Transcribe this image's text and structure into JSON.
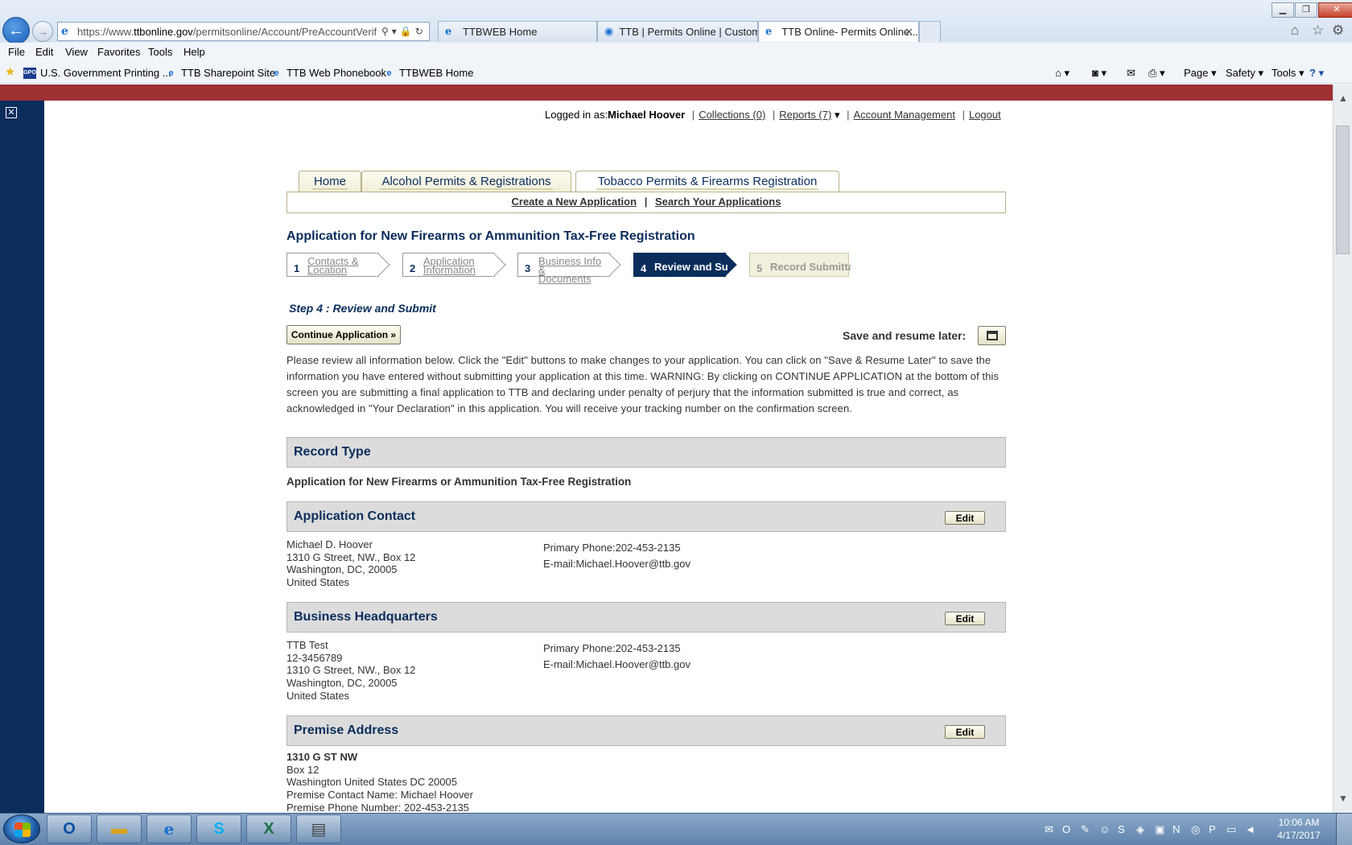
{
  "browser": {
    "url_prefix": "https://www.",
    "url_domain": "ttbonline.gov",
    "url_path": "/permitsonline/Account/PreAccountVerific",
    "tabs": [
      {
        "label": "TTBWEB Home"
      },
      {
        "label": "TTB | Permits Online | Custom..."
      },
      {
        "label": "TTB Online- Permits Online..."
      }
    ],
    "menu": [
      "File",
      "Edit",
      "View",
      "Favorites",
      "Tools",
      "Help"
    ],
    "favorites": [
      "U.S. Government Printing ...",
      "TTB Sharepoint Site",
      "TTB Web Phonebook",
      "TTBWEB Home"
    ],
    "commands": [
      "Page",
      "Safety",
      "Tools"
    ]
  },
  "header": {
    "logged_in_label": "Logged in as:",
    "user_name": "Michael Hoover",
    "collections": "Collections (0)",
    "reports": "Reports (7)",
    "account_management": "Account Management",
    "logout": "Logout"
  },
  "tabs": {
    "home": "Home",
    "alcohol": "Alcohol Permits & Registrations",
    "tobacco": "Tobacco Permits & Firearms Registration"
  },
  "subnav": {
    "create": "Create a New Application",
    "search": "Search Your Applications"
  },
  "page_title": "Application for New Firearms or Ammunition Tax-Free Registration",
  "steps": [
    {
      "num": "1",
      "line1": "Contacts &",
      "line2": "Location"
    },
    {
      "num": "2",
      "line1": "Application",
      "line2": "Information"
    },
    {
      "num": "3",
      "line1": "Business Info &",
      "line2": "Documents"
    },
    {
      "num": "4",
      "label": "Review and Submit"
    },
    {
      "num": "5",
      "label": "Record Submittal"
    }
  ],
  "step_heading": "Step 4 : Review and Submit",
  "continue_label": "Continue Application »",
  "save_label": "Save and resume later:",
  "instructions": "Please review all information below. Click the \"Edit\" buttons to make changes to your application. You can click on \"Save & Resume Later\" to save the information you have entered without submitting your application at this time. WARNING: By clicking on CONTINUE APPLICATION at the bottom of this screen you are submitting a final application to TTB and declaring under penalty of perjury that the information submitted is true and correct, as acknowledged in \"Your Declaration\" in this application. You will receive your tracking number on the confirmation screen.",
  "edit_label": "Edit",
  "record_type": {
    "title": "Record Type",
    "value": "Application for New Firearms or Ammunition Tax-Free Registration"
  },
  "application_contact": {
    "title": "Application Contact",
    "address": [
      "Michael D. Hoover",
      "1310 G Street, NW., Box 12",
      "Washington, DC, 20005",
      "United States"
    ],
    "phone": "Primary Phone:202-453-2135",
    "email": "E-mail:Michael.Hoover@ttb.gov"
  },
  "business_hq": {
    "title": "Business Headquarters",
    "address": [
      "TTB Test",
      "12-3456789",
      "1310 G Street, NW., Box 12",
      "Washington, DC, 20005",
      "United States"
    ],
    "phone": "Primary Phone:202-453-2135",
    "email": "E-mail:Michael.Hoover@ttb.gov"
  },
  "premise": {
    "title": "Premise Address",
    "street": "1310 G ST NW",
    "lines": [
      "Box 12",
      "Washington United States DC 20005",
      "Premise Contact Name: Michael Hoover",
      "Premise Phone Number: 202-453-2135"
    ]
  },
  "taskbar": {
    "time": "10:06 AM",
    "date": "4/17/2017"
  }
}
